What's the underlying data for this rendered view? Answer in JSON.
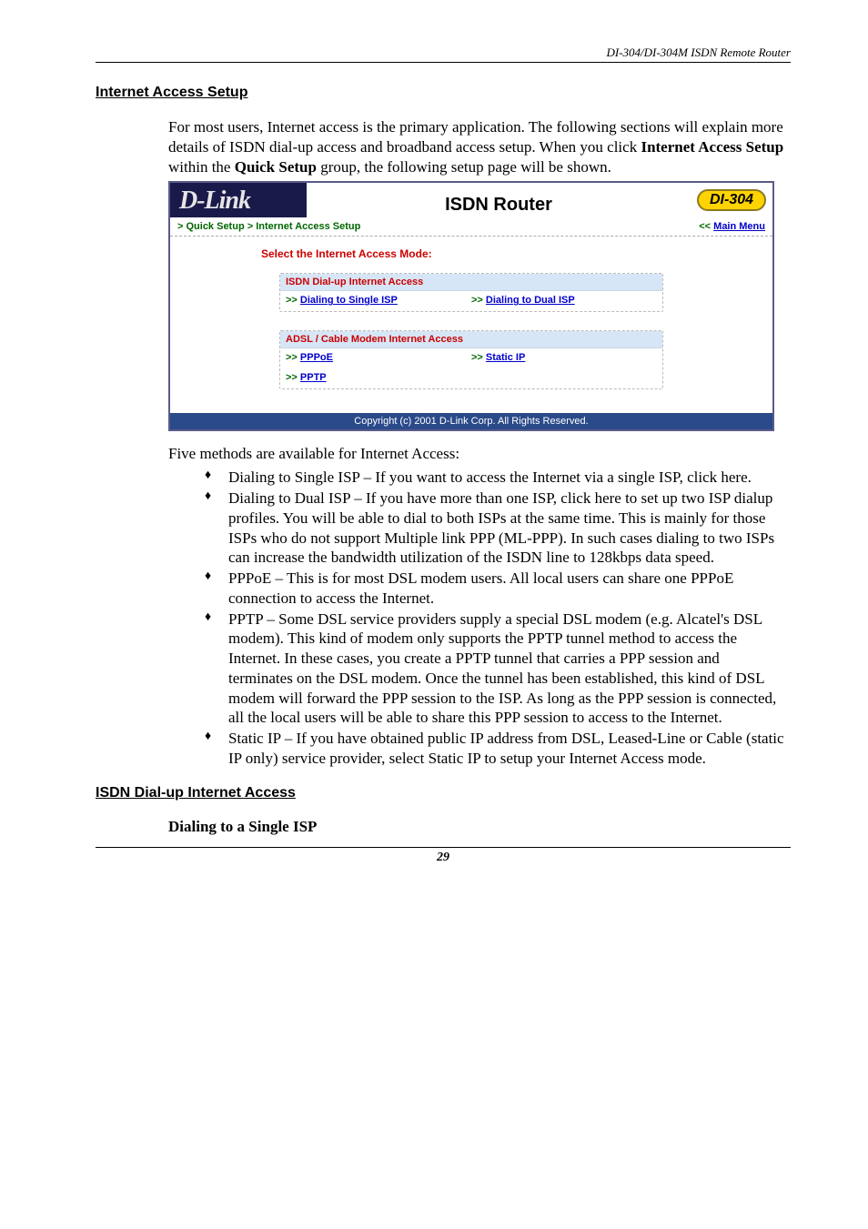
{
  "header": {
    "text": "DI-304/DI-304M ISDN Remote Router"
  },
  "section1": {
    "heading": "Internet Access Setup",
    "intro_pre": "For most users, Internet access is the primary application. The following sections will explain more details of ISDN dial-up access and broadband access setup. When you click ",
    "intro_b1": "Internet Access Setup",
    "intro_mid": " within the ",
    "intro_b2": "Quick Setup",
    "intro_post": " group, the following setup page will be shown."
  },
  "router": {
    "brand": "D-Link",
    "title": "ISDN Router",
    "model": "DI-304",
    "breadcrumb": {
      "prefix": "> ",
      "a": "Quick Setup",
      "sep": " > ",
      "b": "Internet Access Setup"
    },
    "mainmenu": {
      "arrows": "<< ",
      "label": "Main Menu"
    },
    "mode_heading": "Select the Internet Access Mode:",
    "panel1": {
      "title": "ISDN Dial-up Internet Access",
      "link1": "Dialing to Single ISP",
      "link2": "Dialing to Dual ISP"
    },
    "panel2": {
      "title": "ADSL / Cable Modem Internet Access",
      "link1": "PPPoE",
      "link2": "Static IP",
      "link3": "PPTP"
    },
    "footer": "Copyright (c) 2001 D-Link Corp. All Rights Reserved."
  },
  "methods_intro": "Five methods are available for Internet Access:",
  "bullets": {
    "b1_t": "Dialing to Single ISP – ",
    "b1_d": "If you want to access the Internet via a single ISP, click here.",
    "b2_t": "Dialing to Dual ISP – ",
    "b2_d": "If you have more than one ISP, click here to set up two ISP dialup profiles. You will be able to dial to both ISPs at the same time. This is mainly for those ISPs who do not support Multiple link PPP (ML-PPP). In such cases dialing to two ISPs can increase the bandwidth utilization of the ISDN line to 128kbps data speed.",
    "b3_t": "PPPoE – ",
    "b3_d": "This is for most DSL modem users. All local users can share one PPPoE connection to access the Internet.",
    "b4_t": "PPTP – ",
    "b4_d": "Some DSL service providers supply a special DSL modem (e.g. Alcatel's DSL modem). This kind of modem only supports the PPTP tunnel method to access the Internet. In these cases, you create a PPTP tunnel that carries a PPP session and terminates on the DSL modem. Once the tunnel has been established, this kind of DSL modem will forward the PPP session to the ISP. As long as the PPP session is connected, all the local users will be able to share this PPP session to access to the Internet.",
    "b5_t": "Static IP – ",
    "b5_d": "If you have obtained public IP address from DSL, Leased-Line or Cable (static IP only) service provider, select Static IP to setup your Internet Access mode."
  },
  "section2": {
    "heading": "ISDN Dial-up Internet Access",
    "sub": "Dialing to a Single ISP"
  },
  "footer": {
    "page": "29"
  }
}
